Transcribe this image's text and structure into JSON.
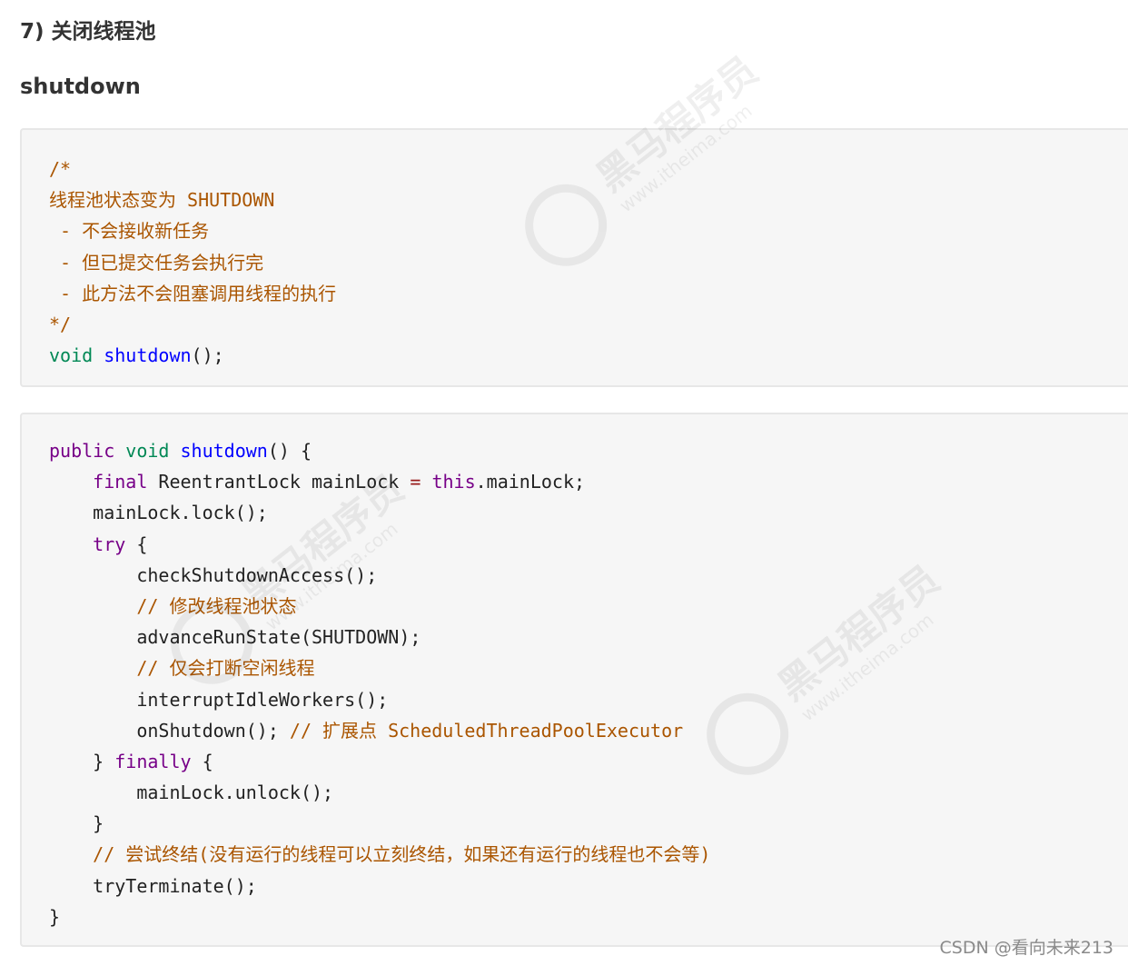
{
  "section_heading": "7) 关闭线程池",
  "method_heading": "shutdown",
  "code_blocks": [
    {
      "lines": [
        [
          {
            "t": "/*",
            "c": "comment"
          }
        ],
        [
          {
            "t": "线程池状态变为 SHUTDOWN",
            "c": "comment"
          }
        ],
        [
          {
            "t": " - 不会接收新任务",
            "c": "comment"
          }
        ],
        [
          {
            "t": " - 但已提交任务会执行完",
            "c": "comment"
          }
        ],
        [
          {
            "t": " - 此方法不会阻塞调用线程的执行",
            "c": "comment"
          }
        ],
        [
          {
            "t": "*/",
            "c": "comment"
          }
        ],
        [
          {
            "t": "void",
            "c": "type"
          },
          {
            "t": " ",
            "c": "plain"
          },
          {
            "t": "shutdown",
            "c": "def"
          },
          {
            "t": "();",
            "c": "plain"
          }
        ]
      ]
    },
    {
      "lines": [
        [
          {
            "t": "public",
            "c": "keyword"
          },
          {
            "t": " ",
            "c": "plain"
          },
          {
            "t": "void",
            "c": "type"
          },
          {
            "t": " ",
            "c": "plain"
          },
          {
            "t": "shutdown",
            "c": "def"
          },
          {
            "t": "() {",
            "c": "plain"
          }
        ],
        [
          {
            "t": "    ",
            "c": "plain"
          },
          {
            "t": "final",
            "c": "keyword"
          },
          {
            "t": " ReentrantLock mainLock ",
            "c": "plain"
          },
          {
            "t": "=",
            "c": "op"
          },
          {
            "t": " ",
            "c": "plain"
          },
          {
            "t": "this",
            "c": "keyword"
          },
          {
            "t": ".mainLock;",
            "c": "plain"
          }
        ],
        [
          {
            "t": "    mainLock.lock();",
            "c": "plain"
          }
        ],
        [
          {
            "t": "    ",
            "c": "plain"
          },
          {
            "t": "try",
            "c": "keyword"
          },
          {
            "t": " {",
            "c": "plain"
          }
        ],
        [
          {
            "t": "        checkShutdownAccess();",
            "c": "plain"
          }
        ],
        [
          {
            "t": "        ",
            "c": "plain"
          },
          {
            "t": "// 修改线程池状态",
            "c": "comment"
          }
        ],
        [
          {
            "t": "        advanceRunState(SHUTDOWN);",
            "c": "plain"
          }
        ],
        [
          {
            "t": "        ",
            "c": "plain"
          },
          {
            "t": "// 仅会打断空闲线程",
            "c": "comment"
          }
        ],
        [
          {
            "t": "        interruptIdleWorkers();",
            "c": "plain"
          }
        ],
        [
          {
            "t": "        onShutdown(); ",
            "c": "plain"
          },
          {
            "t": "// 扩展点 ScheduledThreadPoolExecutor",
            "c": "comment"
          }
        ],
        [
          {
            "t": "    } ",
            "c": "plain"
          },
          {
            "t": "finally",
            "c": "keyword"
          },
          {
            "t": " {",
            "c": "plain"
          }
        ],
        [
          {
            "t": "        mainLock.unlock();",
            "c": "plain"
          }
        ],
        [
          {
            "t": "    }",
            "c": "plain"
          }
        ],
        [
          {
            "t": "    ",
            "c": "plain"
          },
          {
            "t": "// 尝试终结(没有运行的线程可以立刻终结，如果还有运行的线程也不会等)",
            "c": "comment"
          }
        ],
        [
          {
            "t": "    tryTerminate();",
            "c": "plain"
          }
        ],
        [
          {
            "t": "}",
            "c": "plain"
          }
        ]
      ]
    }
  ],
  "watermark": {
    "brand": "黑马程序员",
    "url": "www.itheima.com"
  },
  "credit": "CSDN @看向未来213",
  "colors": {
    "comment": "#aa5500",
    "keyword": "#770088",
    "type": "#008855",
    "def": "#0000ff",
    "operator": "#981a1a",
    "code_background": "#f6f6f6",
    "code_border": "#e7e7e7"
  }
}
